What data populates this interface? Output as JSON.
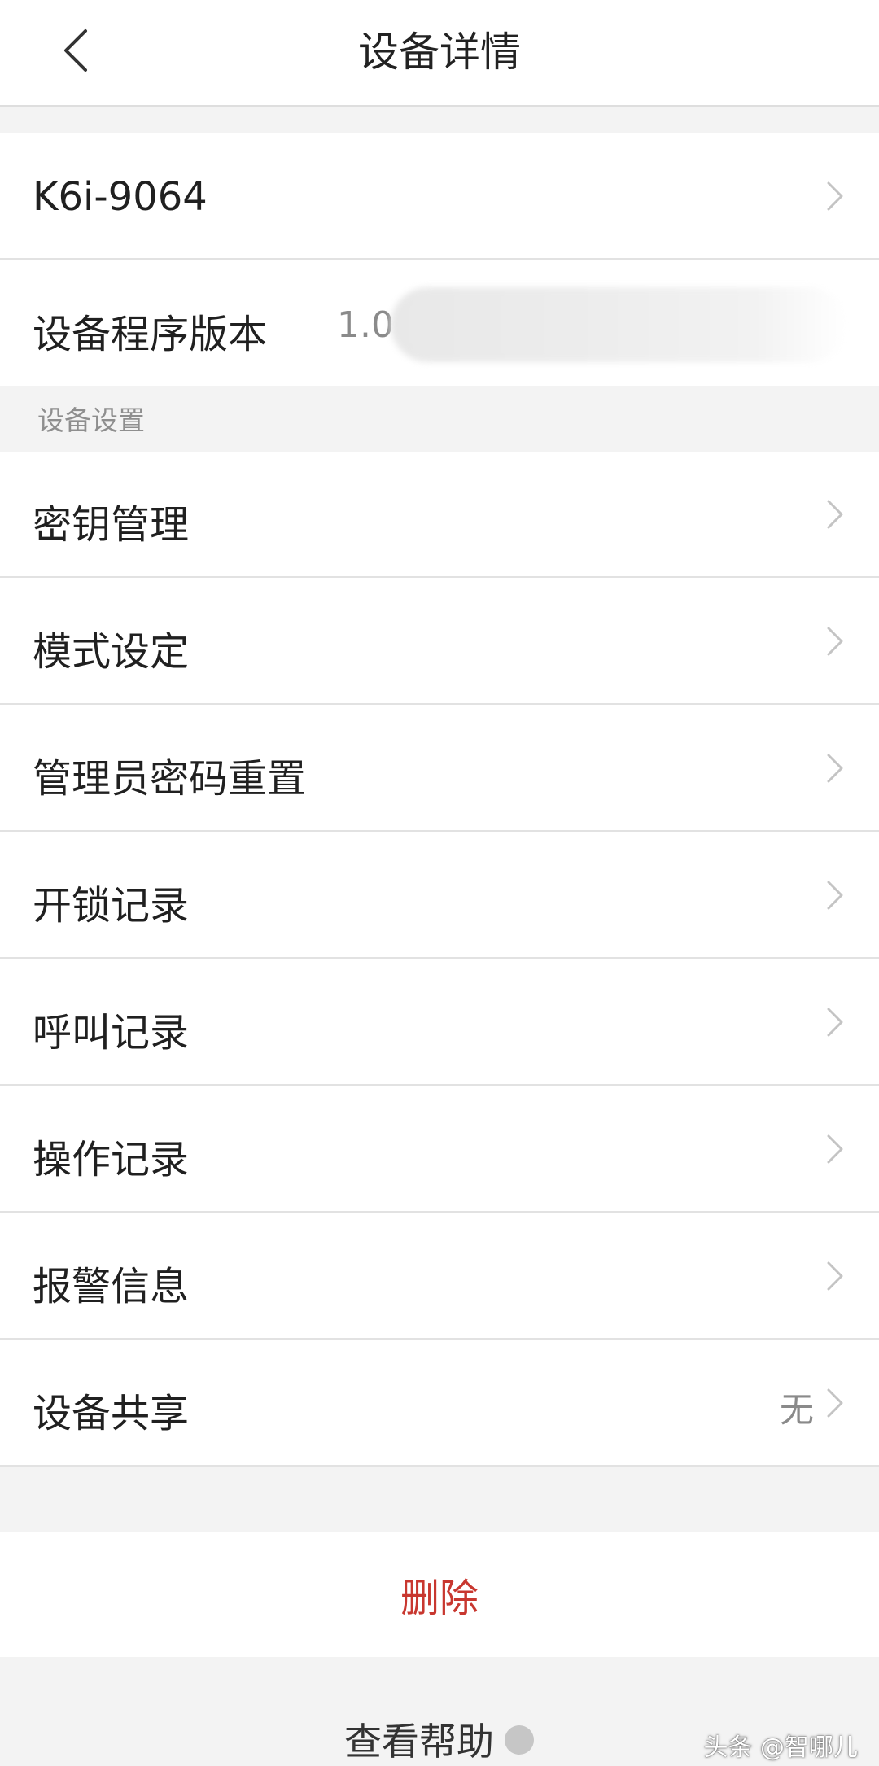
{
  "header": {
    "title": "设备详情",
    "back_icon": "chevron-left-icon"
  },
  "device": {
    "name": "K6i-9064",
    "version_label": "设备程序版本",
    "version_value": "1.0"
  },
  "settings": {
    "section_label": "设备设置",
    "items": [
      {
        "label": "密钥管理"
      },
      {
        "label": "模式设定"
      },
      {
        "label": "管理员密码重置"
      },
      {
        "label": "开锁记录"
      },
      {
        "label": "呼叫记录"
      },
      {
        "label": "操作记录"
      },
      {
        "label": "报警信息"
      },
      {
        "label": "设备共享",
        "value": "无"
      }
    ]
  },
  "actions": {
    "delete_label": "删除",
    "help_label": "查看帮助"
  },
  "watermark": "头条 @智哪儿",
  "colors": {
    "delete": "#c8372f",
    "background": "#f3f3f3",
    "secondary_text": "#8a8a8a"
  }
}
